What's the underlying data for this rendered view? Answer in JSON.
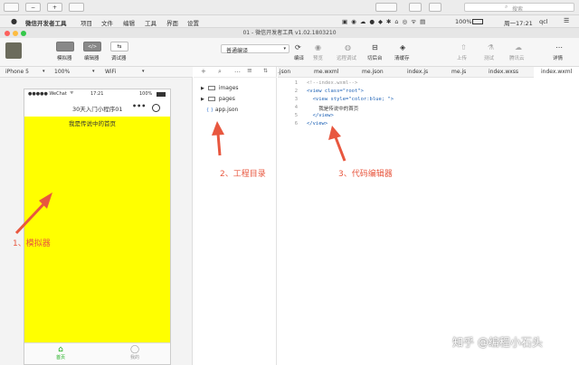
{
  "browser": {
    "search_placeholder": "搜索"
  },
  "menubar": {
    "app_name": "微信开发者工具",
    "items": [
      "项目",
      "文件",
      "编辑",
      "工具",
      "界面",
      "设置"
    ],
    "status": {
      "battery": "100%",
      "datetime": "周一17:21",
      "user": "qcl"
    }
  },
  "window": {
    "title": "01 - 微信开发者工具 v1.02.1803210"
  },
  "toolbar": {
    "simulator_label": "模拟器",
    "editor_label": "编辑器",
    "debugger_label": "调试器",
    "compile_mode": "普通编译",
    "compile_label": "编译",
    "preview_label": "预览",
    "remote_debug_label": "远程调试",
    "background_label": "切后台",
    "clear_cache_label": "清缓存",
    "upload_label": "上传",
    "test_label": "测试",
    "tencent_cloud_label": "腾讯云",
    "details_label": "详情"
  },
  "simbar": {
    "device": "iPhone 5",
    "zoom": "100%",
    "network": "WiFi"
  },
  "phone": {
    "carrier": "●●●●● WeChat",
    "time": "17:21",
    "battery": "100%",
    "nav_title": "30天入门小程序01",
    "page_text": "我是传说中的首页",
    "page_bg": "#ffff00",
    "tabbar": [
      {
        "label": "首页",
        "icon": "home-icon",
        "color": "#1aad19"
      },
      {
        "label": "我的",
        "icon": "user-icon",
        "color": "#999999"
      }
    ]
  },
  "explorer": {
    "items": [
      {
        "label": "images",
        "type": "folder"
      },
      {
        "label": "pages",
        "type": "folder"
      },
      {
        "label": "app.json",
        "type": "file",
        "prefix": "{ }"
      }
    ]
  },
  "editor": {
    "tabs": [
      ".json",
      "me.wxml",
      "me.json",
      "index.js",
      "me.js",
      "index.wxss",
      "index.wxml"
    ],
    "active_tab": "index.wxml",
    "lines": [
      "<!--index.wxml-->",
      "<view class=\"root\">",
      "  <view style=\"color:blue; \">",
      "    我是传说中的首页",
      "  </view>",
      "</view>"
    ],
    "line_numbers": [
      "1",
      "2",
      "3",
      "4",
      "5",
      "6"
    ]
  },
  "annotations": {
    "simulator": "1、模拟器",
    "project": "2、工程目录",
    "code_editor": "3、代码编辑器",
    "color": "#e8573f"
  },
  "watermark": "知乎 @编程小石头"
}
